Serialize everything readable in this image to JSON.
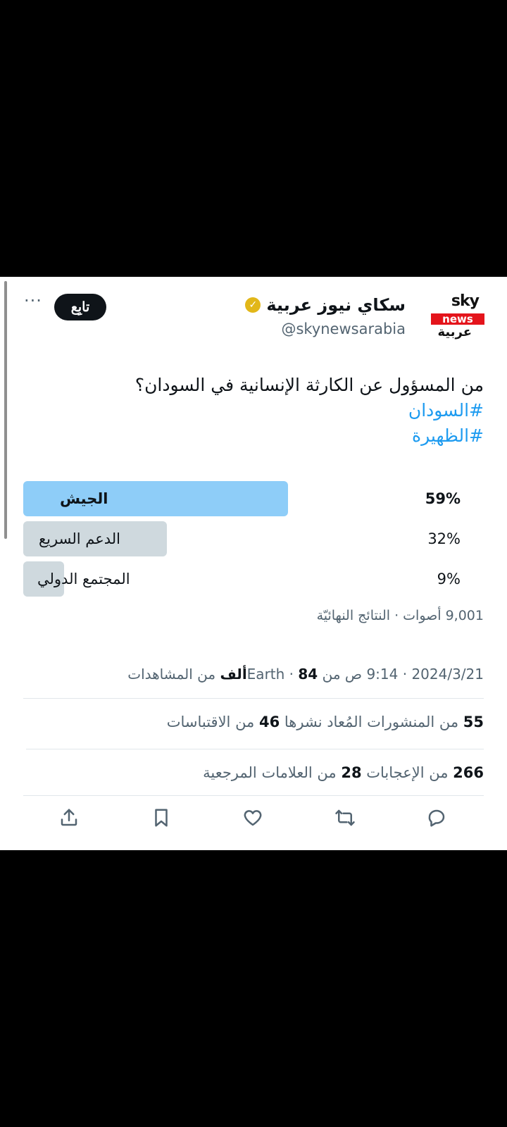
{
  "account": {
    "logo_top": "sky",
    "logo_mid": "news",
    "logo_ar": "عربية",
    "display_name": "سكاي نيوز عربية",
    "handle": "@skynewsarabia",
    "verified_icon": "verified-badge-icon",
    "follow_label": "تابِع",
    "more_label": "···"
  },
  "tweet": {
    "question": "من المسؤول عن الكارثة الإنسانية في السودان؟",
    "hashtag_1": "#السودان",
    "hashtag_2": "#الظهيرة"
  },
  "poll": {
    "options": [
      {
        "label": "الجيش",
        "percent_text": "59%",
        "percent": 59,
        "winner": true
      },
      {
        "label": "الدعم السريع",
        "percent_text": "32%",
        "percent": 32,
        "winner": false
      },
      {
        "label": "المجتمع الدولي",
        "percent_text": "9%",
        "percent": 9,
        "winner": false
      }
    ],
    "summary": "9,001 أصوات · النتائج النهائيّة",
    "winner_color": "#8ecdf8",
    "other_color": "#cfd9de"
  },
  "meta": {
    "datetime": "2024/3/21 · 9:14 ص من Earth · ",
    "views_count": "84ألف",
    "views_label": " من المشاهدات"
  },
  "stats": {
    "reposts_count": "55",
    "reposts_label": " من المنشورات المُعاد نشرها  ",
    "quotes_count": "46",
    "quotes_label": " من الاقتباسات",
    "likes_count": "266",
    "likes_label": " من الإعجابات  ",
    "bookmarks_count": "28",
    "bookmarks_label": " من العلامات المرجعية"
  },
  "actions": [
    "reply-icon",
    "retweet-icon",
    "like-icon",
    "bookmark-icon",
    "share-icon"
  ]
}
